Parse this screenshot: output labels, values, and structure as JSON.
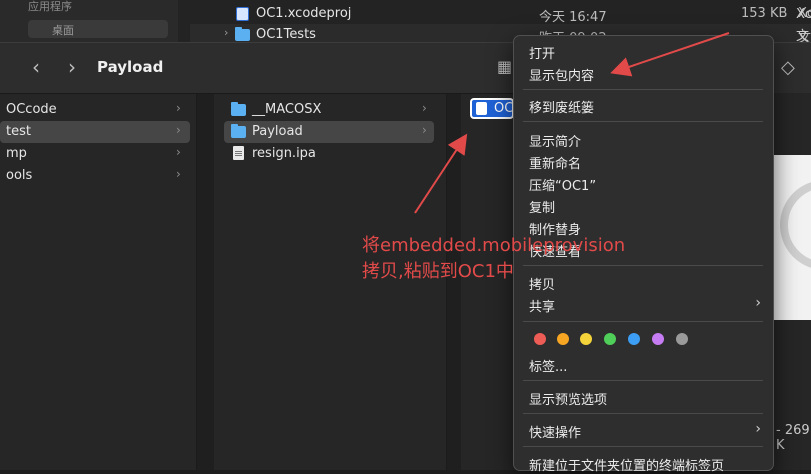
{
  "background_window": {
    "sidebar_items": [
      "应用程序",
      "桌面"
    ],
    "rows": [
      {
        "name": "OC1.xcodeproj",
        "date": "今天 16:47",
        "size": "153 KB",
        "kind": "Xc"
      },
      {
        "name": "OC1Tests",
        "date": "昨天 09:02",
        "size": "",
        "kind": "文"
      }
    ]
  },
  "window": {
    "title": "Payload",
    "back_icon": "chevron-left-icon",
    "forward_icon": "chevron-right-icon"
  },
  "column1": {
    "items": [
      {
        "label": "OCcode",
        "selected": false
      },
      {
        "label": "test",
        "selected": true
      },
      {
        "label": "mp",
        "selected": false
      },
      {
        "label": "ools",
        "selected": false
      }
    ]
  },
  "column2": {
    "items": [
      {
        "label": "__MACOSX",
        "type": "folder",
        "selected": false
      },
      {
        "label": "Payload",
        "type": "folder",
        "selected": true
      },
      {
        "label": "resign.ipa",
        "type": "file",
        "selected": false
      }
    ]
  },
  "column3": {
    "selected_item": "OC"
  },
  "preview": {
    "size_text": "- 269 K"
  },
  "context_menu": {
    "items": {
      "open": "打开",
      "show_package_contents": "显示包内容",
      "move_to_trash": "移到废纸篓",
      "get_info": "显示简介",
      "rename": "重新命名",
      "compress": "压缩“OC1”",
      "duplicate": "复制",
      "make_alias": "制作替身",
      "quick_look": "快速查看",
      "copy": "拷贝",
      "share": "共享",
      "tags": "标签...",
      "show_preview_options": "显示预览选项",
      "quick_actions": "快速操作",
      "new_terminal": "新建位于文件夹位置的终端标签页"
    },
    "tag_colors": [
      "#ee5d55",
      "#f6a623",
      "#f5d33a",
      "#4fcf59",
      "#3c9ef5",
      "#c67cf2",
      "#9a9a9a"
    ]
  },
  "annotation": {
    "line1": "将embedded.mobileprovision",
    "line2": "拷贝,粘贴到OC1中",
    "color": "#e24a4a"
  }
}
